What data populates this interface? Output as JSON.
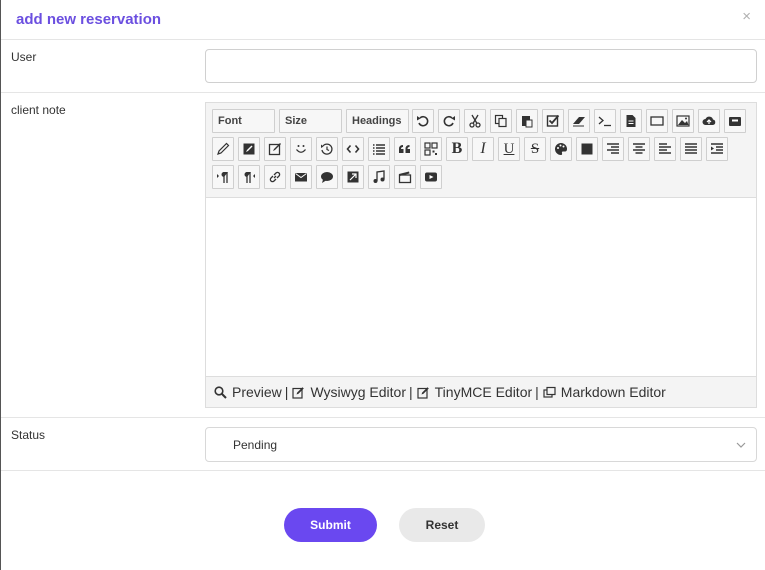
{
  "modal": {
    "title": "add new reservation",
    "close_glyph": "×"
  },
  "form": {
    "user": {
      "label": "User",
      "value": ""
    },
    "client_note": {
      "label": "client note",
      "value": ""
    },
    "status": {
      "label": "Status",
      "selected": "Pending"
    }
  },
  "editor": {
    "dropdowns": {
      "font": "Font",
      "size": "Size",
      "headings": "Headings"
    },
    "format_buttons": {
      "bold": "B",
      "italic": "I",
      "underline": "U",
      "strike": "S"
    },
    "modes": {
      "preview": "Preview",
      "wysiwyg": "Wysiwyg Editor",
      "tinymce": "TinyMCE Editor",
      "markdown": "Markdown Editor",
      "separator": "|"
    }
  },
  "actions": {
    "submit": "Submit",
    "reset": "Reset"
  },
  "colors": {
    "accent": "#6a48f0",
    "title": "#6b4fe0"
  }
}
